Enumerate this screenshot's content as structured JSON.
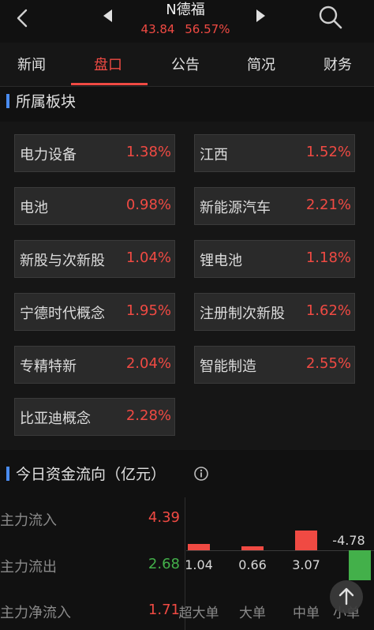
{
  "header": {
    "title": "N德福",
    "price": "43.84",
    "change_pct": "56.57%"
  },
  "tabs": [
    {
      "label": "新闻"
    },
    {
      "label": "盘口"
    },
    {
      "label": "公告"
    },
    {
      "label": "简况"
    },
    {
      "label": "财务"
    }
  ],
  "sectors": {
    "title": "所属板块",
    "items": [
      {
        "name": "电力设备",
        "pct": "1.38%"
      },
      {
        "name": "江西",
        "pct": "1.52%"
      },
      {
        "name": "电池",
        "pct": "0.98%"
      },
      {
        "name": "新能源汽车",
        "pct": "2.21%"
      },
      {
        "name": "新股与次新股",
        "pct": "1.04%"
      },
      {
        "name": "锂电池",
        "pct": "1.18%"
      },
      {
        "name": "宁德时代概念",
        "pct": "1.95%"
      },
      {
        "name": "注册制次新股",
        "pct": "1.62%"
      },
      {
        "name": "专精特新",
        "pct": "2.04%"
      },
      {
        "name": "智能制造",
        "pct": "2.55%"
      },
      {
        "name": "比亚迪概念",
        "pct": "2.28%"
      }
    ]
  },
  "fund_flow": {
    "title": "今日资金流向（亿元）",
    "rows": [
      {
        "label": "主力流入",
        "value": "4.39"
      },
      {
        "label": "主力流出",
        "value": "2.68"
      },
      {
        "label": "主力净流入",
        "value": "1.71"
      }
    ]
  },
  "chart_data": {
    "type": "bar",
    "categories": [
      "超大单",
      "大单",
      "中单",
      "小单"
    ],
    "values": [
      1.04,
      0.66,
      3.07,
      -4.78
    ],
    "labels": [
      "1.04",
      "0.66",
      "3.07",
      "-4.78"
    ]
  },
  "colors": {
    "up": "#f04a43",
    "down": "#43b04a",
    "accent": "#4a8cf0",
    "background": "#111111",
    "tile": "#2a2a2a"
  },
  "icons": {
    "back": "chevron-left-icon",
    "prev": "triangle-left-icon",
    "next": "triangle-right-icon",
    "search": "search-icon",
    "info": "info-icon",
    "scroll_top": "arrow-up-icon"
  }
}
